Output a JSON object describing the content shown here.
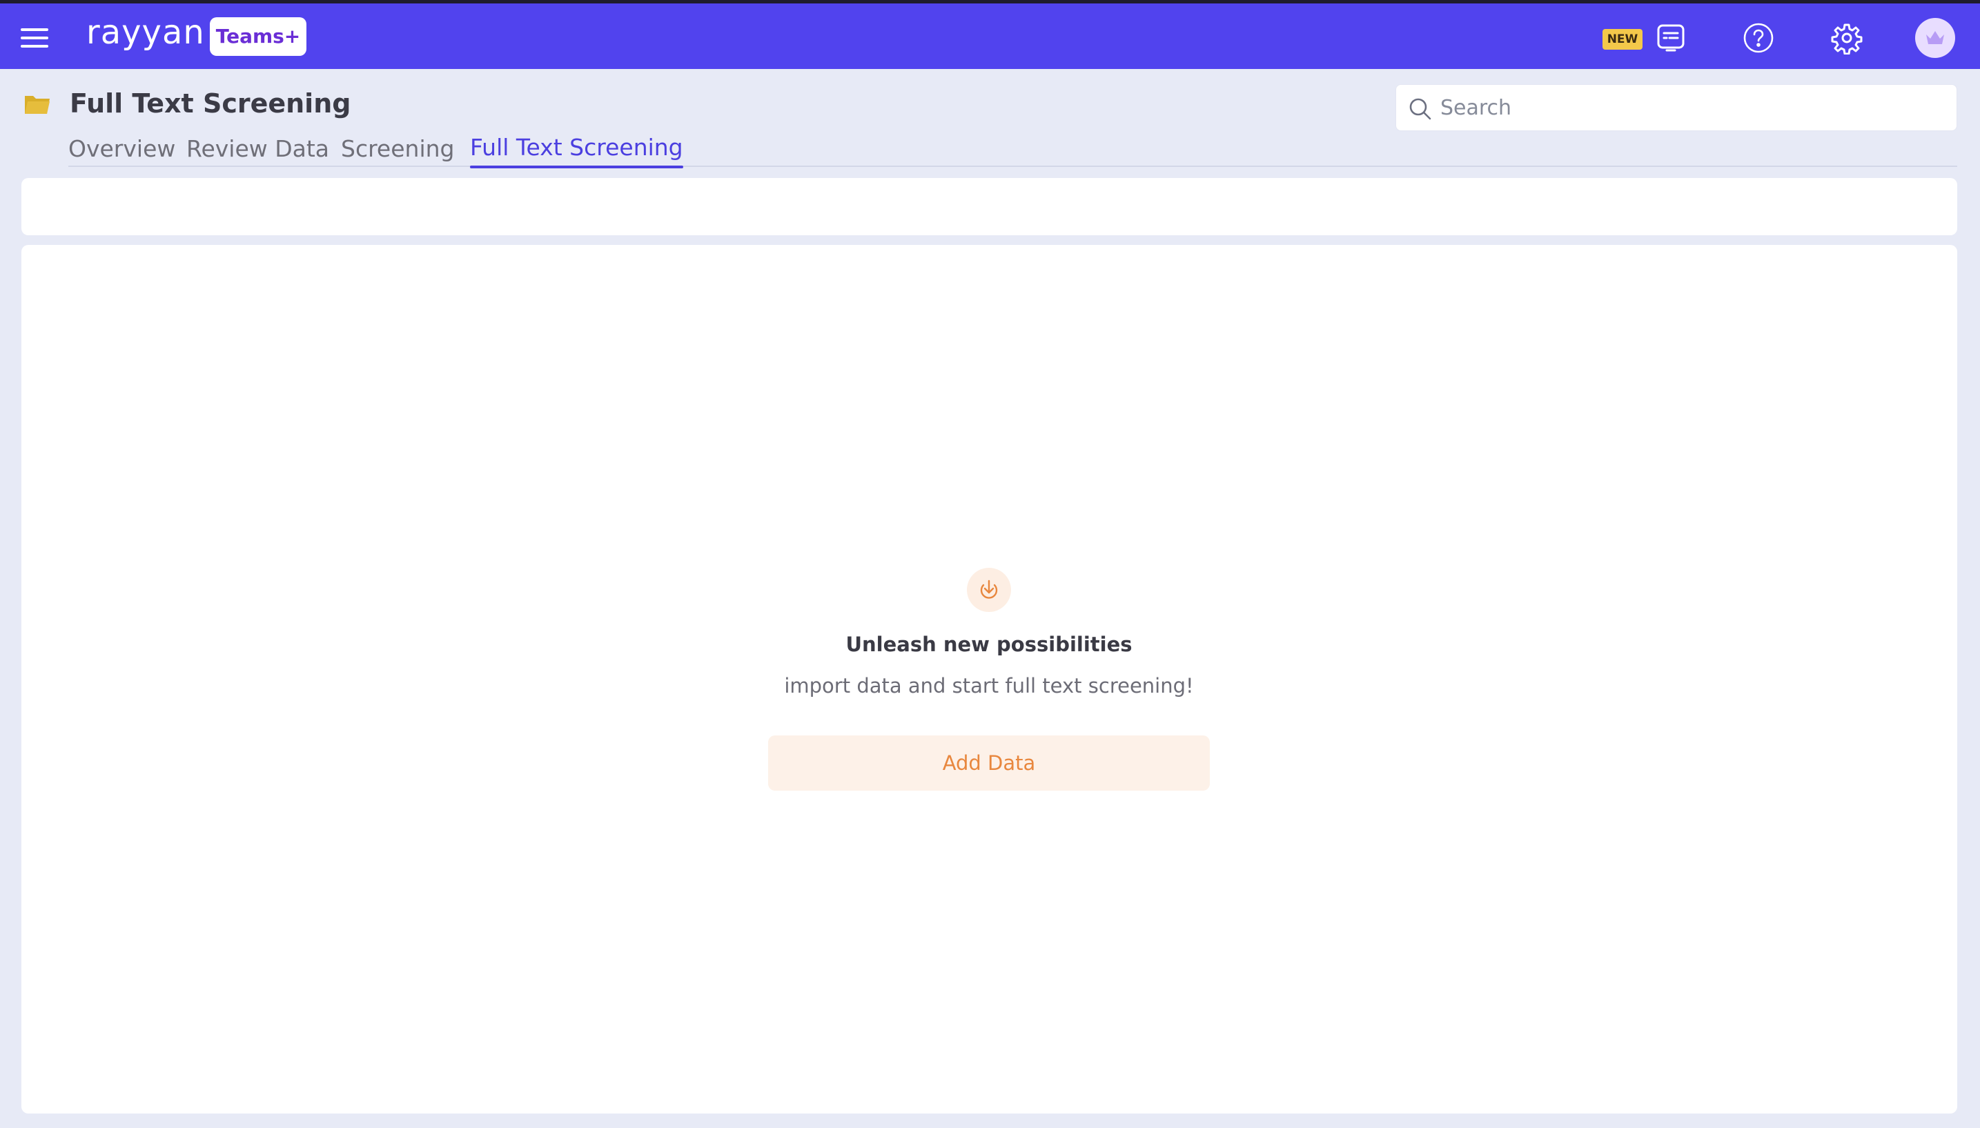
{
  "header": {
    "logo_text": "rayyan",
    "plan_badge": "Teams+",
    "new_badge": "NEW"
  },
  "page": {
    "title": "Full Text Screening"
  },
  "search": {
    "placeholder": "Search",
    "value": ""
  },
  "tabs": [
    {
      "label": "Overview",
      "active": false
    },
    {
      "label": "Review Data",
      "active": false
    },
    {
      "label": "Screening",
      "active": false
    },
    {
      "label": "Full Text Screening",
      "active": true
    }
  ],
  "empty_state": {
    "title": "Unleash new possibilities",
    "subtitle": "import data and start full text screening!",
    "button_label": "Add Data",
    "icon": "download-icon"
  },
  "colors": {
    "header_bg": "#5143ee",
    "active_tab": "#4b3fe0",
    "accent_orange": "#e8873e",
    "page_bg": "#e7eaf6"
  }
}
